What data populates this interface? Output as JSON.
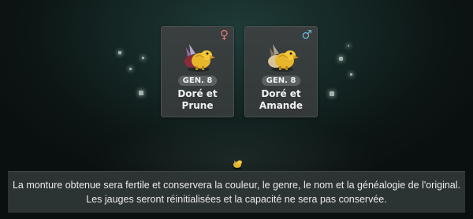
{
  "parents": [
    {
      "gender_symbol": "♀",
      "gender_color": "#e07b7b",
      "generation": "GEN. 8",
      "name_line1": "Doré et",
      "name_line2": "Prune",
      "colors": {
        "primary": "#e8b62c",
        "secondary": "#8a2a3a"
      }
    },
    {
      "gender_symbol": "♂",
      "gender_color": "#6fb6cf",
      "generation": "GEN. 8",
      "name_line1": "Doré et",
      "name_line2": "Amande",
      "colors": {
        "primary": "#e8b62c",
        "secondary": "#d8c49a"
      }
    }
  ],
  "info": {
    "line1": "La monture obtenue sera fertile et conservera la couleur, le genre, le nom et la généalogie de l'original.",
    "line2": "Les jauges seront réinitialisées et la capacité ne sera pas conservée."
  }
}
